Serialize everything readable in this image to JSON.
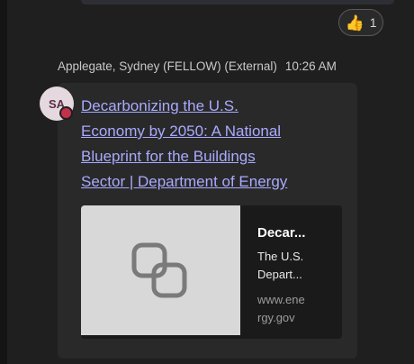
{
  "reaction": {
    "emoji": "👍",
    "icon": "thumbs-up-icon",
    "count": "1"
  },
  "message": {
    "sender": "Applegate, Sydney (FELLOW) (External)",
    "time": "10:26 AM",
    "avatar_initials": "SA",
    "presence_color": "#c4314b",
    "link_lines": [
      "Decarbonizing the U.S.",
      "Economy by 2050: A National",
      "Blueprint for the Buildings",
      "Sector | Department of Energy"
    ]
  },
  "preview": {
    "icon": "link-icon",
    "title": "Decar...",
    "description_lines": [
      "The U.S.",
      "Depart..."
    ],
    "domain_lines": [
      "www.ene",
      "rgy.gov"
    ]
  },
  "colors": {
    "background": "#1f1f1f",
    "bubble": "#292929",
    "link": "#a9aaff",
    "avatar_bg": "#e5d9df"
  }
}
